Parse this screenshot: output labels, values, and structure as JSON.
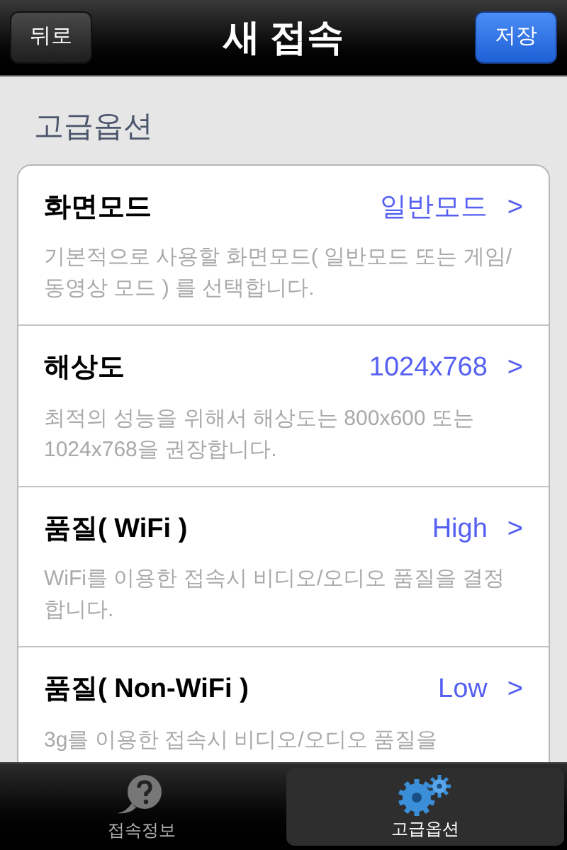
{
  "nav_bar": {
    "back_button": "뒤로",
    "title": "새 접속",
    "save_button": "저장"
  },
  "section_header": "고급옵션",
  "settings": [
    {
      "label": "화면모드",
      "value": "일반모드",
      "chevron": ">",
      "description": "기본적으로 사용할 화면모드( 일반모드 또는 게임/동영상 모드 ) 를 선택합니다."
    },
    {
      "label": "해상도",
      "value": "1024x768",
      "chevron": ">",
      "description": "최적의 성능을 위해서 해상도는 800x600 또는 1024x768을 권장합니다."
    },
    {
      "label": "품질( WiFi )",
      "value": "High",
      "chevron": ">",
      "description": "WiFi를 이용한 접속시 비디오/오디오 품질을 결정합니다."
    },
    {
      "label": "품질( Non-WiFi )",
      "value": "Low",
      "chevron": ">",
      "description": "3g를 이용한 접속시 비디오/오디오 품질을"
    }
  ],
  "tab_bar": [
    {
      "label": "접속정보",
      "kind": "help",
      "selected": false
    },
    {
      "label": "고급옵션",
      "kind": "gears",
      "selected": true
    }
  ]
}
